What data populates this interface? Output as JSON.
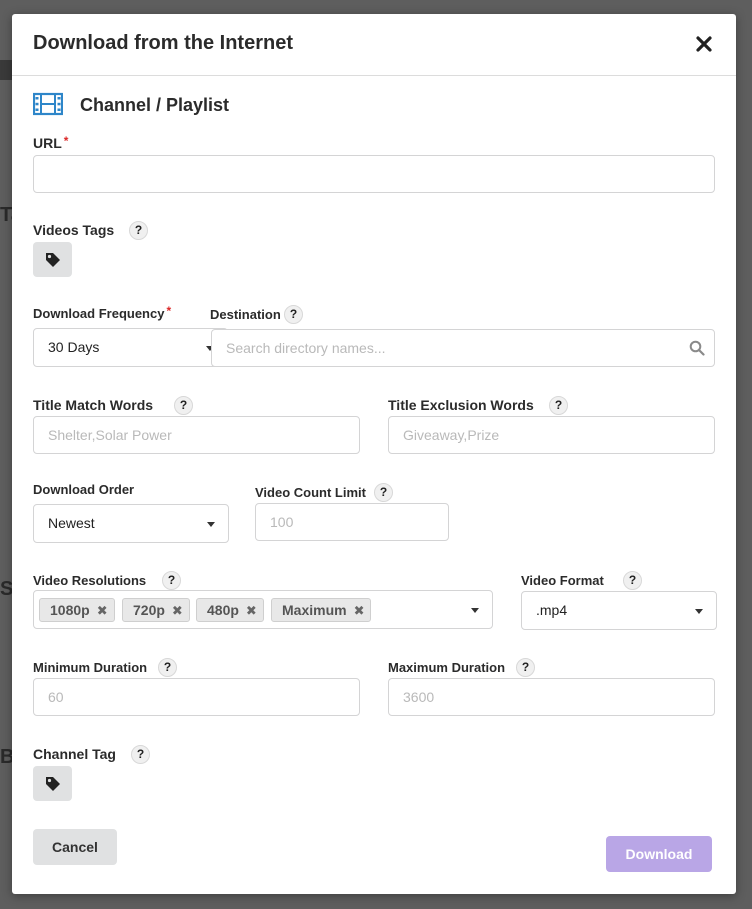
{
  "modal": {
    "title": "Download from the Internet",
    "section_title": "Channel / Playlist"
  },
  "background": {
    "fragments": [
      "Ta",
      "St",
      "Ba"
    ]
  },
  "fields": {
    "url": {
      "label": "URL",
      "required_mark": "*",
      "value": "",
      "placeholder": ""
    },
    "videos_tags": {
      "label": "Videos Tags",
      "help": "?"
    },
    "download_frequency": {
      "label": "Download Frequency",
      "required_mark": "*",
      "value": "30 Days"
    },
    "destination": {
      "label": "Destination",
      "help": "?",
      "placeholder": "Search directory names..."
    },
    "title_match_words": {
      "label": "Title Match Words",
      "help": "?",
      "placeholder": "Shelter,Solar Power"
    },
    "title_exclusion_words": {
      "label": "Title Exclusion Words",
      "help": "?",
      "placeholder": "Giveaway,Prize"
    },
    "download_order": {
      "label": "Download Order",
      "value": "Newest"
    },
    "video_count_limit": {
      "label": "Video Count Limit",
      "help": "?",
      "placeholder": "100"
    },
    "video_resolutions": {
      "label": "Video Resolutions",
      "help": "?",
      "selected": [
        "1080p",
        "720p",
        "480p",
        "Maximum"
      ],
      "remove_glyph": "✖"
    },
    "video_format": {
      "label": "Video Format",
      "help": "?",
      "value": ".mp4"
    },
    "minimum_duration": {
      "label": "Minimum Duration",
      "help": "?",
      "placeholder": "60"
    },
    "maximum_duration": {
      "label": "Maximum Duration",
      "help": "?",
      "placeholder": "3600"
    },
    "channel_tag": {
      "label": "Channel Tag",
      "help": "?"
    }
  },
  "actions": {
    "cancel_label": "Cancel",
    "download_label": "Download"
  },
  "icons": {
    "close": "close-icon",
    "film": "film-icon",
    "tag": "tag-icon",
    "search": "search-icon",
    "caret": "caret-down-icon"
  },
  "colors": {
    "accent_film": "#2e86c9",
    "primary_disabled": "#b9a6e6",
    "required": "#db2828",
    "overlay": "#5e5e5e"
  }
}
